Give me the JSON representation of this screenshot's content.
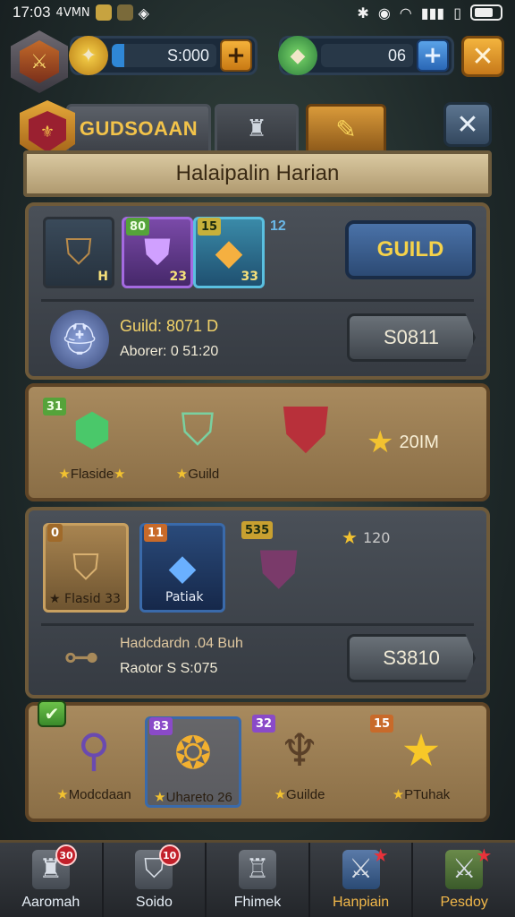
{
  "status_bar": {
    "time": "17:03",
    "carrier": "4VMN"
  },
  "resources": {
    "gold": "S:000",
    "gems": "06"
  },
  "tabs": {
    "main_label": "GUDSOAAN"
  },
  "title": "Halaipalin Harian",
  "panel1": {
    "slots": [
      {
        "badge": "",
        "num": "H",
        "icon": "shield"
      },
      {
        "badge": "80",
        "num": "23",
        "icon": "purple-shield"
      },
      {
        "badge": "15",
        "num": "33",
        "icon": "gem"
      }
    ],
    "extra_count": "12",
    "guild_button": "GUILD",
    "line1": "Guild: 8071 D",
    "line2": "Aborer: 0 51:20",
    "cta": "S0811"
  },
  "panel2": {
    "badge": "31",
    "rewards": [
      "Flaside",
      "Guild"
    ],
    "amount": "20IM"
  },
  "panel3": {
    "slots": [
      {
        "badge": "0",
        "caption": "Flasid",
        "num": "33"
      },
      {
        "badge": "11",
        "caption": "Patiak"
      },
      {
        "badge": "535",
        "caption": ""
      }
    ],
    "star_count": "120",
    "line1": "Hadcdardn .04 Buh",
    "line2": "Raotor S S:075",
    "cta": "S3810"
  },
  "panel4": {
    "items": [
      {
        "badge": "",
        "caption": "Modcdaan"
      },
      {
        "badge": "83",
        "caption": "Uhareto 26"
      },
      {
        "badge": "32",
        "caption": "Guilde"
      },
      {
        "badge": "15",
        "caption": "PTuhak"
      }
    ]
  },
  "bottom_nav": [
    {
      "label": "Aaromah",
      "badge": "30"
    },
    {
      "label": "Soido",
      "badge": "10"
    },
    {
      "label": "Fhimek",
      "badge": ""
    },
    {
      "label": "Hanpiain",
      "badge": ""
    },
    {
      "label": "Pesdoy",
      "badge": ""
    }
  ],
  "colors": {
    "accent_gold": "#f2b84a",
    "panel_tan": "#a88a5e",
    "panel_dark": "#4a5058"
  }
}
